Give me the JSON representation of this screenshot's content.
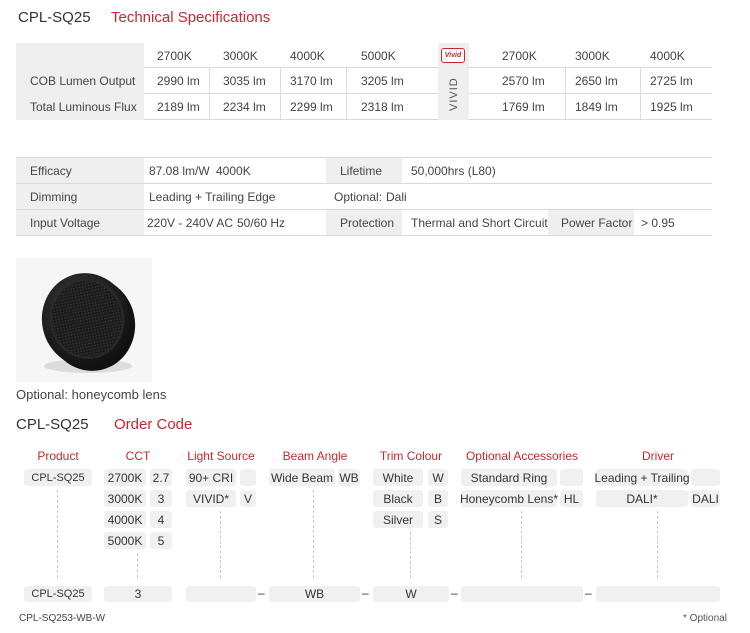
{
  "tech": {
    "model": "CPL-SQ25",
    "title": "Technical Specifications",
    "cct_headers": [
      "2700K",
      "3000K",
      "4000K",
      "5000K"
    ],
    "vivid_headers": [
      "2700K",
      "3000K",
      "4000K"
    ],
    "vivid_badge": "Vivid",
    "vivid_label": "VIVID",
    "rows": [
      {
        "label": "COB Lumen Output",
        "values": [
          "2990 lm",
          "3035 lm",
          "3170 lm",
          "3205 lm"
        ],
        "vivid": [
          "2570 lm",
          "2650 lm",
          "2725 lm"
        ]
      },
      {
        "label": "Total Luminous Flux",
        "values": [
          "2189 lm",
          "2234 lm",
          "2299 lm",
          "2318 lm"
        ],
        "vivid": [
          "1769 lm",
          "1849 lm",
          "1925 lm"
        ]
      }
    ]
  },
  "specs": {
    "efficacy_label": "Efficacy",
    "efficacy_value": "87.08 lm/W",
    "efficacy_cct": "4000K",
    "lifetime_label": "Lifetime",
    "lifetime_value": "50,000hrs (L80)",
    "dimming_label": "Dimming",
    "dimming_value": "Leading + Trailing Edge",
    "optional_label": "Optional:",
    "optional_value": "Dali",
    "voltage_label": "Input Voltage",
    "voltage_value": "220V - 240V AC",
    "voltage_freq": "50/60 Hz",
    "protection_label": "Protection",
    "protection_value": "Thermal and Short Circuit",
    "pf_label": "Power Factor",
    "pf_value": "> 0.95"
  },
  "lens": {
    "caption": "Optional: honeycomb lens"
  },
  "order": {
    "model": "CPL-SQ25",
    "title": "Order Code",
    "columns": {
      "product": "Product",
      "cct": "CCT",
      "light_source": "Light Source",
      "beam_angle": "Beam Angle",
      "trim_colour": "Trim Colour",
      "accessories": "Optional Accessories",
      "driver": "Driver"
    },
    "product_code": "CPL-SQ25",
    "cct_options": [
      {
        "label": "2700K",
        "code": "2.7"
      },
      {
        "label": "3000K",
        "code": "3"
      },
      {
        "label": "4000K",
        "code": "4"
      },
      {
        "label": "5000K",
        "code": "5"
      }
    ],
    "light_options": [
      {
        "label": "90+ CRI",
        "code": ""
      },
      {
        "label": "VIVID*",
        "code": "V"
      }
    ],
    "beam_options": [
      {
        "label": "Wide Beam",
        "code": "WB"
      }
    ],
    "trim_options": [
      {
        "label": "White",
        "code": "W"
      },
      {
        "label": "Black",
        "code": "B"
      },
      {
        "label": "Silver",
        "code": "S"
      }
    ],
    "accessory_options": [
      {
        "label": "Standard Ring",
        "code": ""
      },
      {
        "label": "Honeycomb Lens*",
        "code": "HL"
      }
    ],
    "driver_options": [
      {
        "label": "Leading + Trailing",
        "code": ""
      },
      {
        "label": "DALI*",
        "code": "DALI"
      }
    ],
    "example": {
      "product": "CPL-SQ25",
      "cct": "3",
      "light": "",
      "beam": "WB",
      "trim": "W",
      "accessory": "",
      "driver": "",
      "separator": "–"
    },
    "example_code": "CPL-SQ253-WB-W",
    "footnote": "* Optional"
  },
  "colors": {
    "accent": "#c5282f",
    "cell_bg": "#efefef",
    "pill_bg": "#f0f0f0"
  }
}
